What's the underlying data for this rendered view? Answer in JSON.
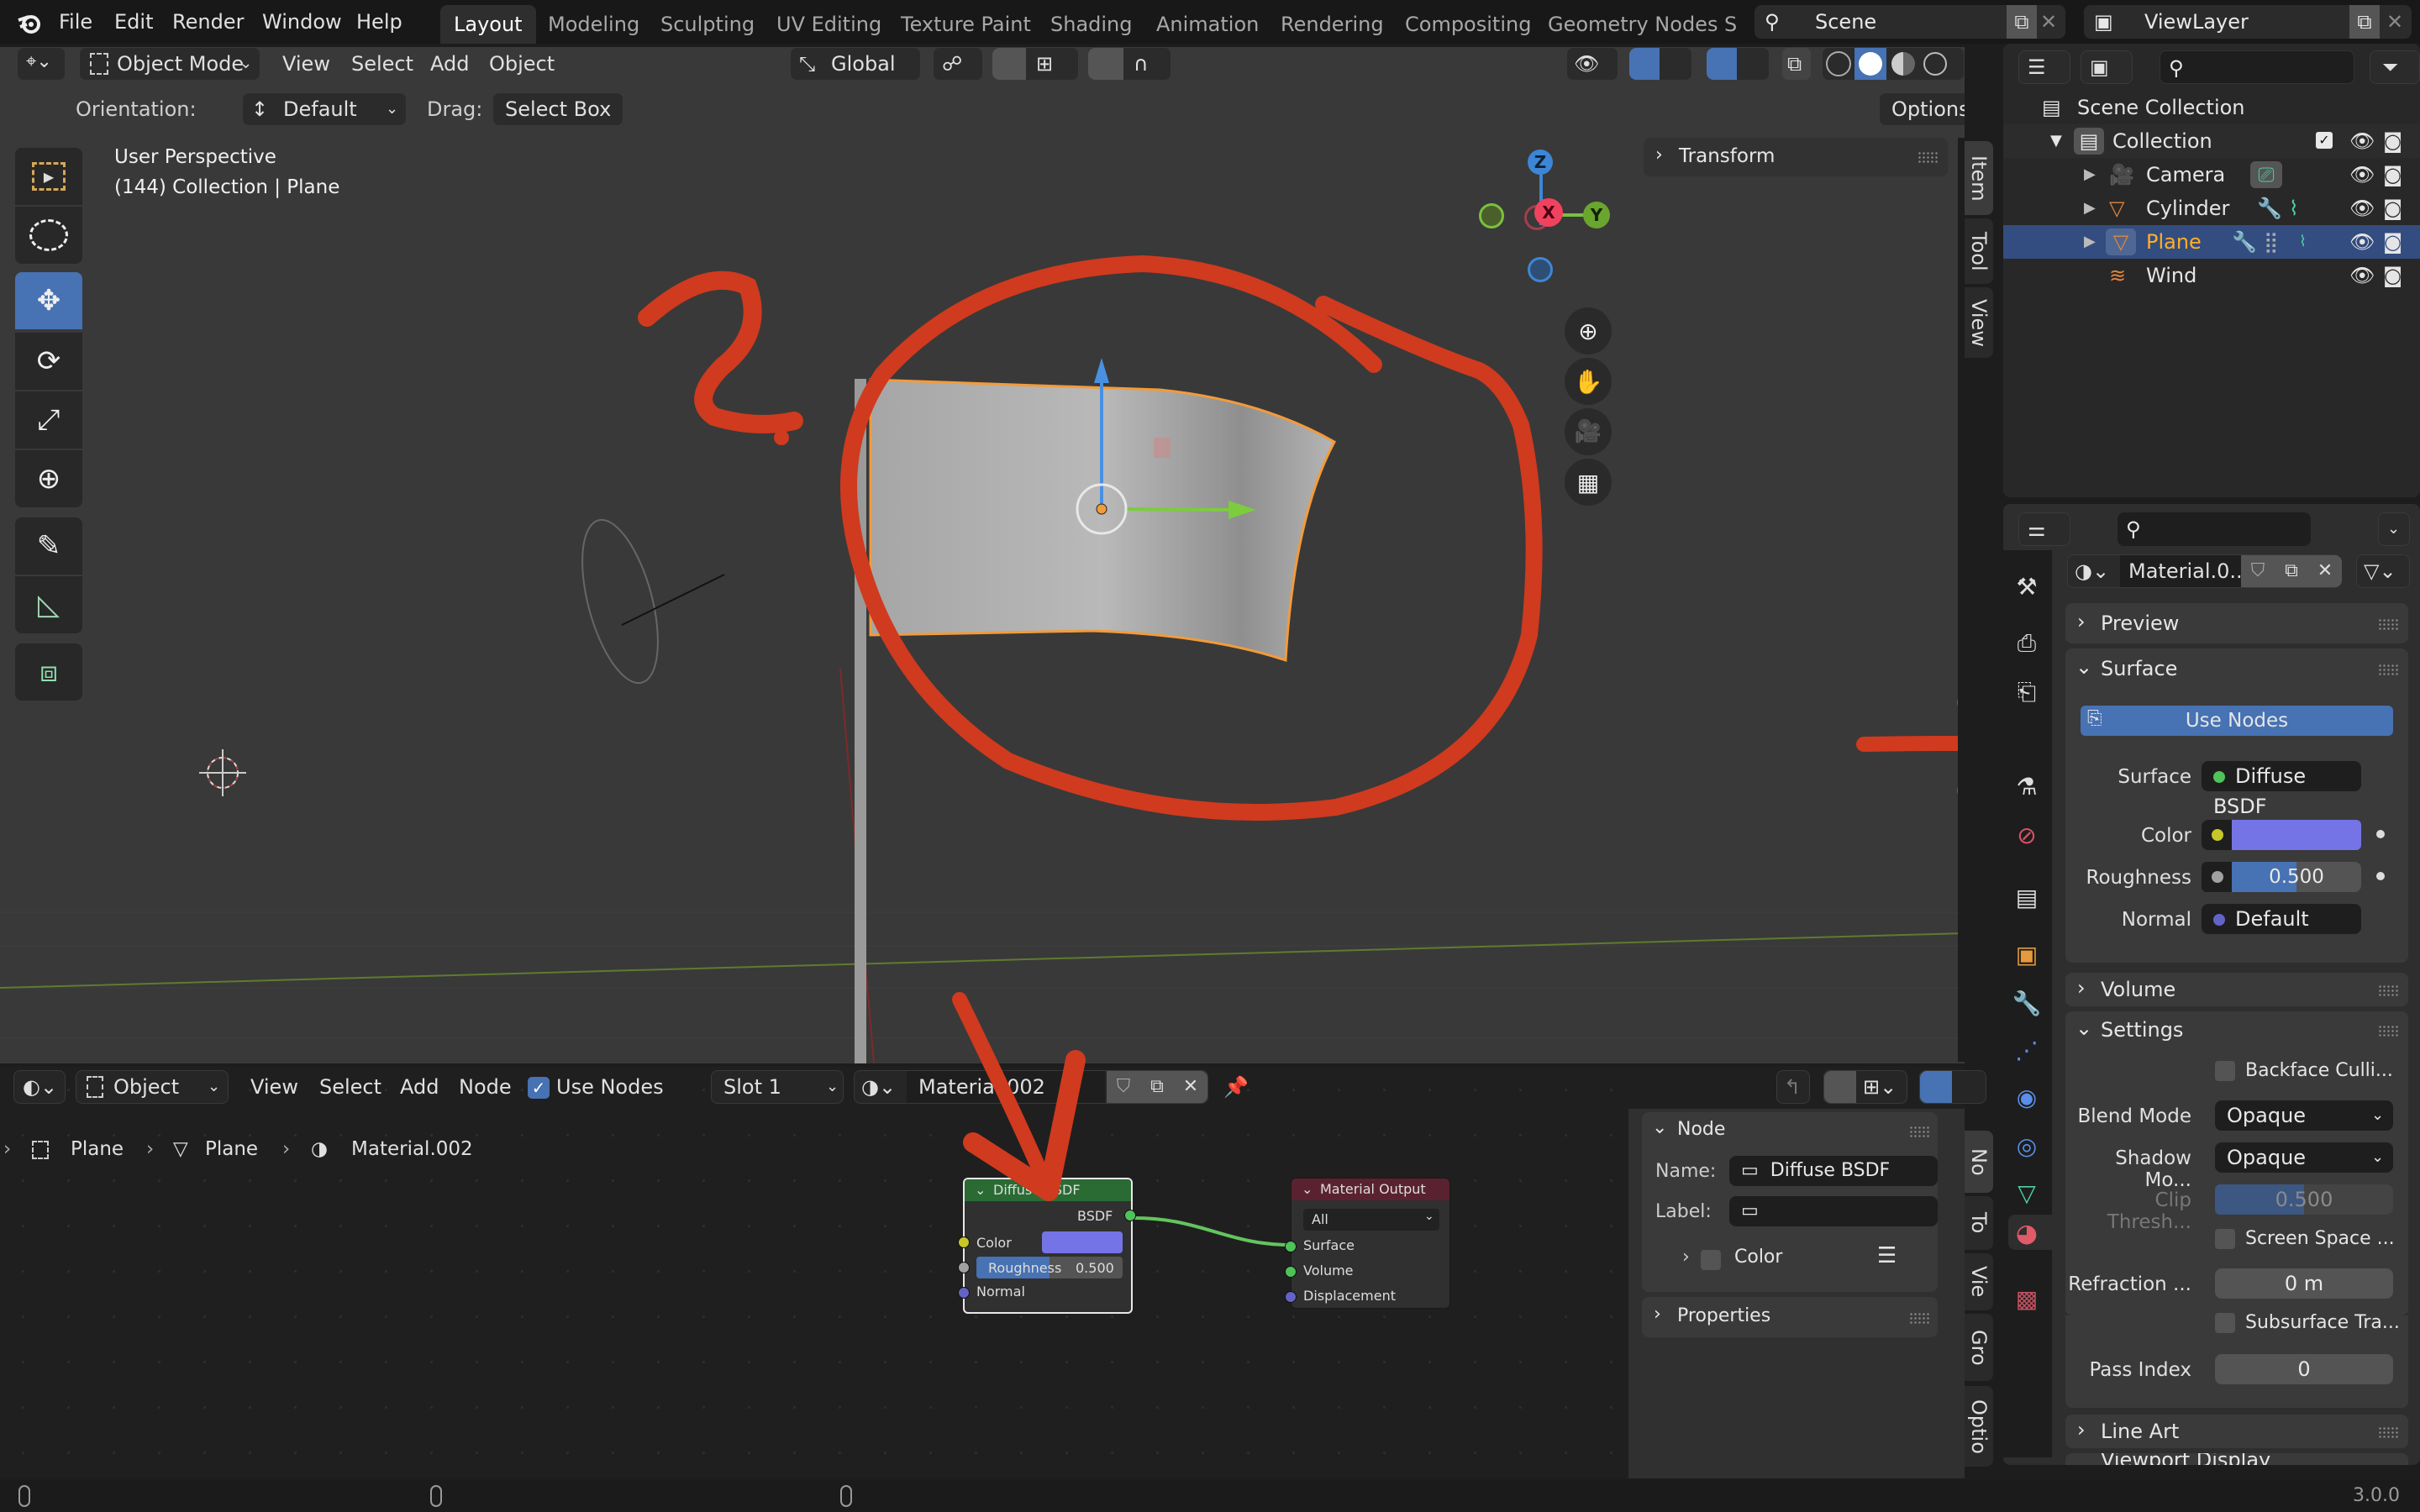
{
  "topbar": {
    "menus": [
      "File",
      "Edit",
      "Render",
      "Window",
      "Help"
    ],
    "workspaces": [
      "Layout",
      "Modeling",
      "Sculpting",
      "UV Editing",
      "Texture Paint",
      "Shading",
      "Animation",
      "Rendering",
      "Compositing",
      "Geometry Nodes",
      "S"
    ],
    "active_workspace": "Layout",
    "scene": "Scene",
    "view_layer": "ViewLayer"
  },
  "viewport": {
    "mode": "Object Mode",
    "menus": [
      "View",
      "Select",
      "Add",
      "Object"
    ],
    "transform_orientation": "Global",
    "orientation_label": "Orientation:",
    "orientation_value": "Default",
    "drag_label": "Drag:",
    "drag_value": "Select Box",
    "options_label": "Options",
    "overlay_title": "User Perspective",
    "overlay_subtitle": "(144) Collection | Plane",
    "sidebar_panel": "Transform",
    "sidebar_tabs": [
      "Item",
      "Tool",
      "View"
    ],
    "gizmo": {
      "z": "Z",
      "x": "X",
      "y": "Y"
    },
    "annotations": {
      "question_mark": "?",
      "colors": {
        "annotation": "#d03a1e"
      }
    }
  },
  "outliner": {
    "search_placeholder": "",
    "root": "Scene Collection",
    "collection": "Collection",
    "items": [
      {
        "name": "Camera",
        "selected": false
      },
      {
        "name": "Cylinder",
        "selected": false
      },
      {
        "name": "Plane",
        "selected": true
      },
      {
        "name": "Wind",
        "selected": false
      }
    ]
  },
  "properties": {
    "search_placeholder": "",
    "material_name": "Material.0...",
    "panels": {
      "preview": "Preview",
      "surface": "Surface",
      "use_nodes": "Use Nodes",
      "surface_label": "Surface",
      "surface_value": "Diffuse BSDF",
      "color_label": "Color",
      "color_value": "#7574e6",
      "roughness_label": "Roughness",
      "roughness_value": "0.500",
      "roughness_fraction": 0.5,
      "normal_label": "Normal",
      "normal_value": "Default",
      "volume": "Volume",
      "settings": "Settings",
      "backface": "Backface Culli...",
      "blend_mode_label": "Blend Mode",
      "blend_mode_value": "Opaque",
      "shadow_mode_label": "Shadow Mo...",
      "shadow_mode_value": "Opaque",
      "clip_label": "Clip Thresh...",
      "clip_value": "0.500",
      "screen_space": "Screen Space ...",
      "refraction_label": "Refraction ...",
      "refraction_value": "0 m",
      "subsurface": "Subsurface Tra...",
      "pass_index_label": "Pass Index",
      "pass_index_value": "0",
      "line_art": "Line Art",
      "viewport_display": "Viewport Display"
    }
  },
  "node_editor": {
    "type": "Object",
    "menus": [
      "View",
      "Select",
      "Add",
      "Node"
    ],
    "use_nodes_label": "Use Nodes",
    "use_nodes_checked": true,
    "slot": "Slot 1",
    "material": "Material.002",
    "breadcrumb": [
      "Plane",
      "Plane",
      "Material.002"
    ],
    "diffuse_node": {
      "title": "Diffuse BSDF",
      "output": "BSDF",
      "color_label": "Color",
      "roughness_label": "Roughness",
      "roughness_value": "0.500",
      "normal_label": "Normal"
    },
    "output_node": {
      "title": "Material Output",
      "target": "All",
      "inputs": [
        "Surface",
        "Volume",
        "Displacement"
      ]
    },
    "sidebar": {
      "node_panel": "Node",
      "name_label": "Name:",
      "name_value": "Diffuse BSDF",
      "label_label": "Label:",
      "label_value": "",
      "color_label": "Color",
      "properties_panel": "Properties",
      "tabs": [
        "No",
        "To",
        "Vie",
        "Gro",
        "Optio"
      ]
    }
  },
  "statusbar": {
    "version": "3.0.0"
  }
}
